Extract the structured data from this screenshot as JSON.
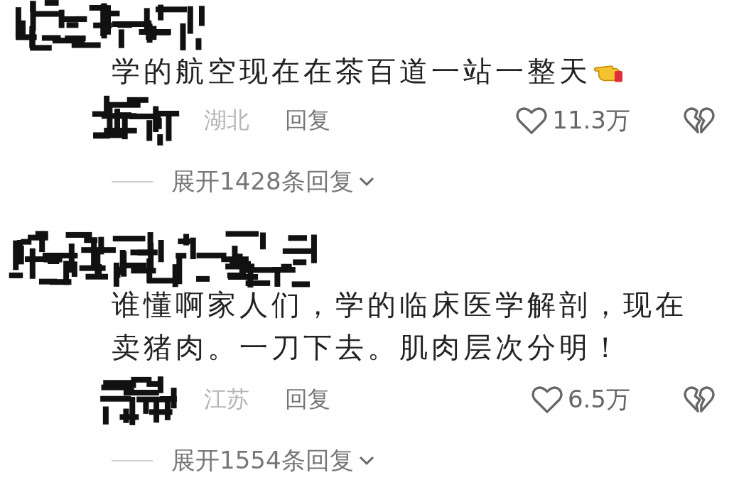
{
  "comments": [
    {
      "text": "学的航空现在在茶百道一站一整天",
      "hand_emoji": true,
      "location": "湖北",
      "reply": "回复",
      "likes": "11.3万",
      "expand": "展开1428条回复"
    },
    {
      "text": "谁懂啊家人们，学的临床医学解剖，现在卖猪肉。一刀下去。肌肉层次分明！",
      "hand_emoji": false,
      "location": "江苏",
      "reply": "回复",
      "likes": "6.5万",
      "expand": "展开1554条回复"
    }
  ]
}
